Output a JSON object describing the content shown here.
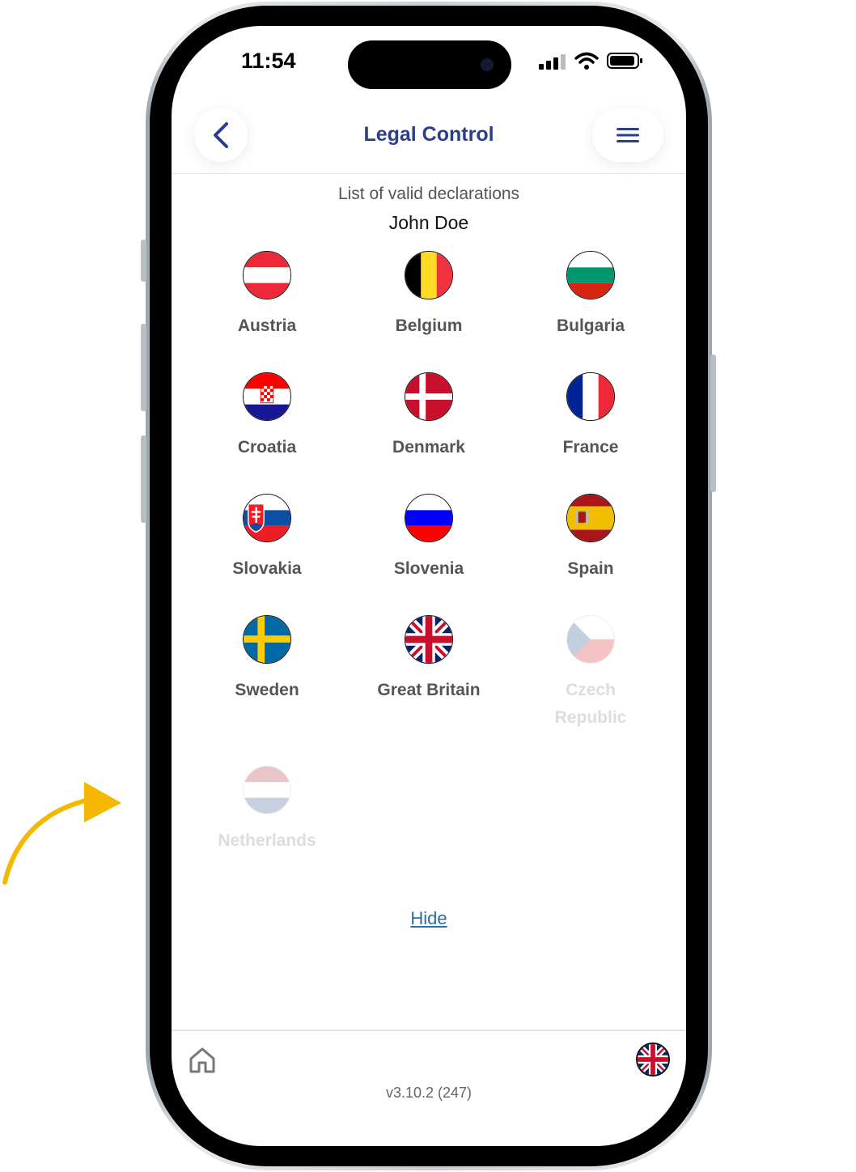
{
  "status_bar": {
    "time": "11:54"
  },
  "header": {
    "title": "Legal Control"
  },
  "page": {
    "subtitle": "List of valid declarations",
    "user_name": "John Doe"
  },
  "countries": [
    {
      "name": "Austria",
      "flag": "austria-flag-icon",
      "enabled": true
    },
    {
      "name": "Belgium",
      "flag": "belgium-flag-icon",
      "enabled": true
    },
    {
      "name": "Bulgaria",
      "flag": "bulgaria-flag-icon",
      "enabled": true
    },
    {
      "name": "Croatia",
      "flag": "croatia-flag-icon",
      "enabled": true
    },
    {
      "name": "Denmark",
      "flag": "denmark-flag-icon",
      "enabled": true
    },
    {
      "name": "France",
      "flag": "france-flag-icon",
      "enabled": true
    },
    {
      "name": "Slovakia",
      "flag": "slovakia-flag-icon",
      "enabled": true
    },
    {
      "name": "Slovenia",
      "flag": "slovenia-flag-icon",
      "enabled": true
    },
    {
      "name": "Spain",
      "flag": "spain-flag-icon",
      "enabled": true
    },
    {
      "name": "Sweden",
      "flag": "sweden-flag-icon",
      "enabled": true
    },
    {
      "name": "Great Britain",
      "flag": "great-britain-flag-icon",
      "enabled": true
    },
    {
      "name": "Czech Republic",
      "flag": "czech-republic-flag-icon",
      "enabled": false
    },
    {
      "name": "Netherlands",
      "flag": "netherlands-flag-icon",
      "enabled": false
    }
  ],
  "actions": {
    "hide_label": "Hide"
  },
  "footer": {
    "version": "v3.10.2 (247)"
  },
  "colors": {
    "title": "#2b3e8c",
    "link": "#2c6ea3",
    "arrow": "#f5b800"
  }
}
